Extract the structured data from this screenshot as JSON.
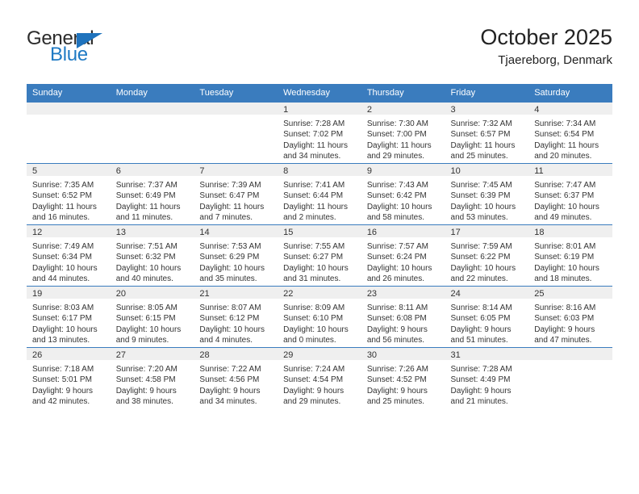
{
  "brand": {
    "name_top": "General",
    "name_bottom": "Blue",
    "triangle_color": "#1f73bd",
    "blue_color": "#1f7ac4"
  },
  "header": {
    "title": "October 2025",
    "subtitle": "Tjaereborg, Denmark"
  },
  "theme": {
    "header_bg": "#3a7cbe",
    "header_text": "#ffffff",
    "daynum_band_bg": "#efefef",
    "cell_bg": "#ffffff",
    "text": "#333333"
  },
  "labels": {
    "sunrise_prefix": "Sunrise:",
    "sunset_prefix": "Sunset:",
    "daylight_prefix": "Daylight:"
  },
  "weekdays": [
    "Sunday",
    "Monday",
    "Tuesday",
    "Wednesday",
    "Thursday",
    "Friday",
    "Saturday"
  ],
  "weeks": [
    [
      {
        "day": "",
        "sunrise": "",
        "sunset": "",
        "daylight": ""
      },
      {
        "day": "",
        "sunrise": "",
        "sunset": "",
        "daylight": ""
      },
      {
        "day": "",
        "sunrise": "",
        "sunset": "",
        "daylight": ""
      },
      {
        "day": "1",
        "sunrise": "Sunrise: 7:28 AM",
        "sunset": "Sunset: 7:02 PM",
        "daylight": "Daylight: 11 hours and 34 minutes."
      },
      {
        "day": "2",
        "sunrise": "Sunrise: 7:30 AM",
        "sunset": "Sunset: 7:00 PM",
        "daylight": "Daylight: 11 hours and 29 minutes."
      },
      {
        "day": "3",
        "sunrise": "Sunrise: 7:32 AM",
        "sunset": "Sunset: 6:57 PM",
        "daylight": "Daylight: 11 hours and 25 minutes."
      },
      {
        "day": "4",
        "sunrise": "Sunrise: 7:34 AM",
        "sunset": "Sunset: 6:54 PM",
        "daylight": "Daylight: 11 hours and 20 minutes."
      }
    ],
    [
      {
        "day": "5",
        "sunrise": "Sunrise: 7:35 AM",
        "sunset": "Sunset: 6:52 PM",
        "daylight": "Daylight: 11 hours and 16 minutes."
      },
      {
        "day": "6",
        "sunrise": "Sunrise: 7:37 AM",
        "sunset": "Sunset: 6:49 PM",
        "daylight": "Daylight: 11 hours and 11 minutes."
      },
      {
        "day": "7",
        "sunrise": "Sunrise: 7:39 AM",
        "sunset": "Sunset: 6:47 PM",
        "daylight": "Daylight: 11 hours and 7 minutes."
      },
      {
        "day": "8",
        "sunrise": "Sunrise: 7:41 AM",
        "sunset": "Sunset: 6:44 PM",
        "daylight": "Daylight: 11 hours and 2 minutes."
      },
      {
        "day": "9",
        "sunrise": "Sunrise: 7:43 AM",
        "sunset": "Sunset: 6:42 PM",
        "daylight": "Daylight: 10 hours and 58 minutes."
      },
      {
        "day": "10",
        "sunrise": "Sunrise: 7:45 AM",
        "sunset": "Sunset: 6:39 PM",
        "daylight": "Daylight: 10 hours and 53 minutes."
      },
      {
        "day": "11",
        "sunrise": "Sunrise: 7:47 AM",
        "sunset": "Sunset: 6:37 PM",
        "daylight": "Daylight: 10 hours and 49 minutes."
      }
    ],
    [
      {
        "day": "12",
        "sunrise": "Sunrise: 7:49 AM",
        "sunset": "Sunset: 6:34 PM",
        "daylight": "Daylight: 10 hours and 44 minutes."
      },
      {
        "day": "13",
        "sunrise": "Sunrise: 7:51 AM",
        "sunset": "Sunset: 6:32 PM",
        "daylight": "Daylight: 10 hours and 40 minutes."
      },
      {
        "day": "14",
        "sunrise": "Sunrise: 7:53 AM",
        "sunset": "Sunset: 6:29 PM",
        "daylight": "Daylight: 10 hours and 35 minutes."
      },
      {
        "day": "15",
        "sunrise": "Sunrise: 7:55 AM",
        "sunset": "Sunset: 6:27 PM",
        "daylight": "Daylight: 10 hours and 31 minutes."
      },
      {
        "day": "16",
        "sunrise": "Sunrise: 7:57 AM",
        "sunset": "Sunset: 6:24 PM",
        "daylight": "Daylight: 10 hours and 26 minutes."
      },
      {
        "day": "17",
        "sunrise": "Sunrise: 7:59 AM",
        "sunset": "Sunset: 6:22 PM",
        "daylight": "Daylight: 10 hours and 22 minutes."
      },
      {
        "day": "18",
        "sunrise": "Sunrise: 8:01 AM",
        "sunset": "Sunset: 6:19 PM",
        "daylight": "Daylight: 10 hours and 18 minutes."
      }
    ],
    [
      {
        "day": "19",
        "sunrise": "Sunrise: 8:03 AM",
        "sunset": "Sunset: 6:17 PM",
        "daylight": "Daylight: 10 hours and 13 minutes."
      },
      {
        "day": "20",
        "sunrise": "Sunrise: 8:05 AM",
        "sunset": "Sunset: 6:15 PM",
        "daylight": "Daylight: 10 hours and 9 minutes."
      },
      {
        "day": "21",
        "sunrise": "Sunrise: 8:07 AM",
        "sunset": "Sunset: 6:12 PM",
        "daylight": "Daylight: 10 hours and 4 minutes."
      },
      {
        "day": "22",
        "sunrise": "Sunrise: 8:09 AM",
        "sunset": "Sunset: 6:10 PM",
        "daylight": "Daylight: 10 hours and 0 minutes."
      },
      {
        "day": "23",
        "sunrise": "Sunrise: 8:11 AM",
        "sunset": "Sunset: 6:08 PM",
        "daylight": "Daylight: 9 hours and 56 minutes."
      },
      {
        "day": "24",
        "sunrise": "Sunrise: 8:14 AM",
        "sunset": "Sunset: 6:05 PM",
        "daylight": "Daylight: 9 hours and 51 minutes."
      },
      {
        "day": "25",
        "sunrise": "Sunrise: 8:16 AM",
        "sunset": "Sunset: 6:03 PM",
        "daylight": "Daylight: 9 hours and 47 minutes."
      }
    ],
    [
      {
        "day": "26",
        "sunrise": "Sunrise: 7:18 AM",
        "sunset": "Sunset: 5:01 PM",
        "daylight": "Daylight: 9 hours and 42 minutes."
      },
      {
        "day": "27",
        "sunrise": "Sunrise: 7:20 AM",
        "sunset": "Sunset: 4:58 PM",
        "daylight": "Daylight: 9 hours and 38 minutes."
      },
      {
        "day": "28",
        "sunrise": "Sunrise: 7:22 AM",
        "sunset": "Sunset: 4:56 PM",
        "daylight": "Daylight: 9 hours and 34 minutes."
      },
      {
        "day": "29",
        "sunrise": "Sunrise: 7:24 AM",
        "sunset": "Sunset: 4:54 PM",
        "daylight": "Daylight: 9 hours and 29 minutes."
      },
      {
        "day": "30",
        "sunrise": "Sunrise: 7:26 AM",
        "sunset": "Sunset: 4:52 PM",
        "daylight": "Daylight: 9 hours and 25 minutes."
      },
      {
        "day": "31",
        "sunrise": "Sunrise: 7:28 AM",
        "sunset": "Sunset: 4:49 PM",
        "daylight": "Daylight: 9 hours and 21 minutes."
      },
      {
        "day": "",
        "sunrise": "",
        "sunset": "",
        "daylight": ""
      }
    ]
  ]
}
